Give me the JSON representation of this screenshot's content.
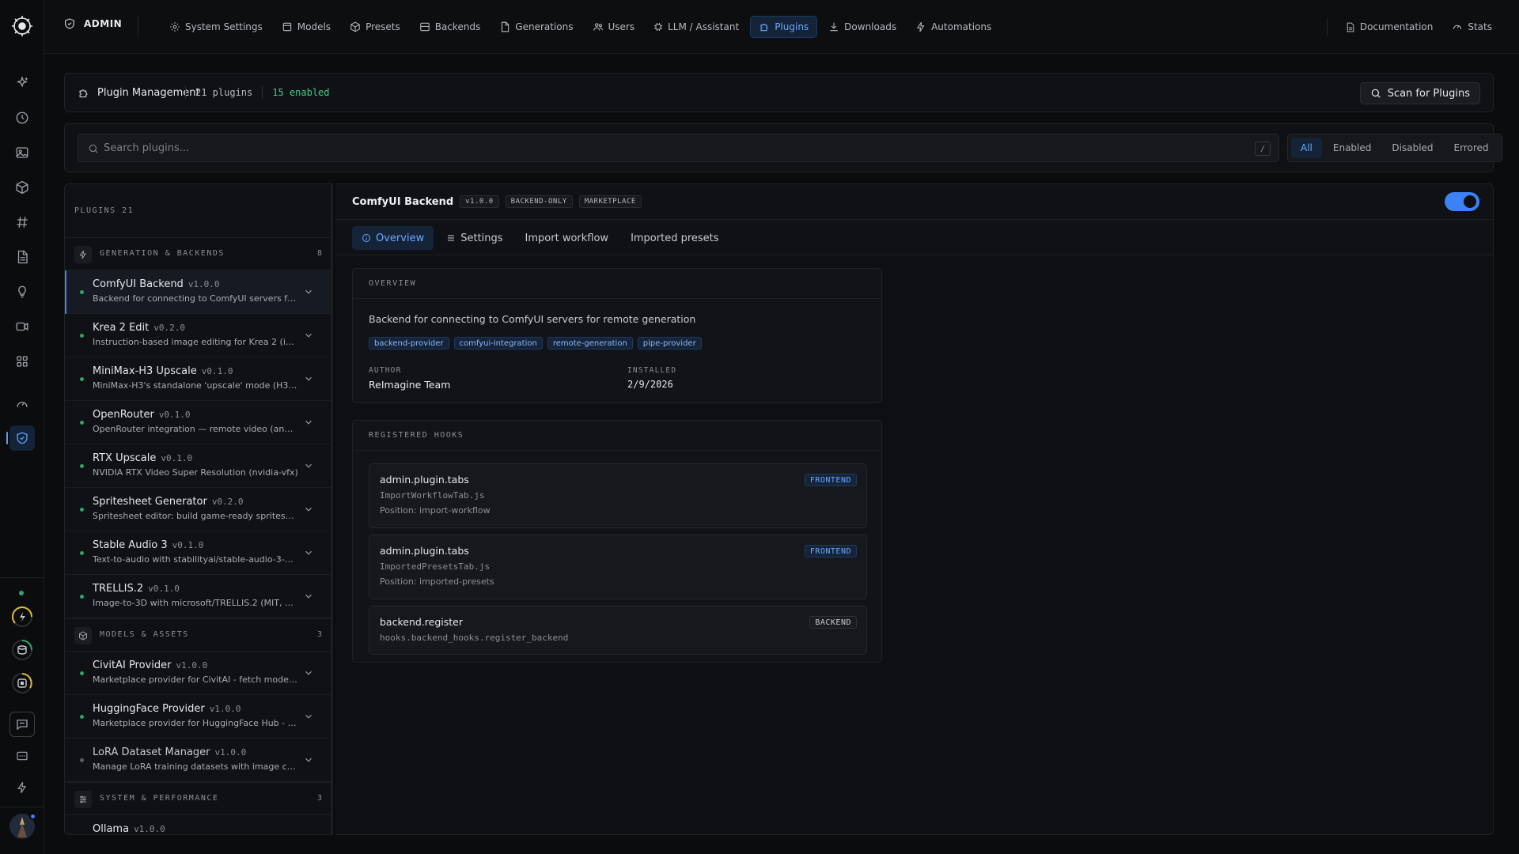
{
  "topbar": {
    "admin_label": "ADMIN",
    "nav": [
      {
        "label": "System Settings",
        "icon": "gear-icon"
      },
      {
        "label": "Models",
        "icon": "box-icon"
      },
      {
        "label": "Presets",
        "icon": "cube-icon"
      },
      {
        "label": "Backends",
        "icon": "server-icon"
      },
      {
        "label": "Generations",
        "icon": "file-icon"
      },
      {
        "label": "Users",
        "icon": "users-icon"
      },
      {
        "label": "LLM / Assistant",
        "icon": "cpu-icon"
      },
      {
        "label": "Plugins",
        "icon": "puzzle-icon",
        "active": true
      },
      {
        "label": "Downloads",
        "icon": "download-icon"
      },
      {
        "label": "Automations",
        "icon": "bolt-icon"
      }
    ],
    "right": [
      {
        "label": "Documentation",
        "icon": "doc-icon"
      },
      {
        "label": "Stats",
        "icon": "gauge-icon"
      }
    ]
  },
  "header": {
    "title": "Plugin Management",
    "plugin_count": "21 plugins",
    "enabled_count": "15 enabled",
    "scan_label": "Scan for Plugins"
  },
  "search": {
    "placeholder": "Search plugins...",
    "shortcut": "/",
    "filters": [
      "All",
      "Enabled",
      "Disabled",
      "Errored"
    ],
    "active_filter": "All"
  },
  "sidebar": {
    "heading": "PLUGINS 21",
    "groups": [
      {
        "label": "GENERATION & BACKENDS",
        "count": "8",
        "icon": "bolt-icon"
      },
      {
        "label": "MODELS & ASSETS",
        "count": "3",
        "icon": "cube-icon"
      },
      {
        "label": "SYSTEM & PERFORMANCE",
        "count": "3",
        "icon": "sliders-icon"
      }
    ],
    "items": [
      {
        "name": "ComfyUI Backend",
        "version": "v1.0.0",
        "desc": "Backend for connecting to ComfyUI servers for remote generation",
        "enabled": true,
        "selected": true
      },
      {
        "name": "Krea 2 Edit",
        "version": "v0.2.0",
        "desc": "Instruction-based image editing for Krea 2 (image-to-image)",
        "enabled": true
      },
      {
        "name": "MiniMax-H3 Upscale",
        "version": "v0.1.0",
        "desc": "MiniMax-H3's standalone 'upscale' mode (H3 upscale model)",
        "enabled": true
      },
      {
        "name": "OpenRouter",
        "version": "v0.1.0",
        "desc": "OpenRouter integration — remote video (and image) generation",
        "enabled": true
      },
      {
        "name": "RTX Upscale",
        "version": "v0.1.0",
        "desc": "NVIDIA RTX Video Super Resolution (nvidia-vfx)",
        "enabled": true
      },
      {
        "name": "Spritesheet Generator",
        "version": "v0.2.0",
        "desc": "Spritesheet editor: build game-ready spritesheets",
        "enabled": true
      },
      {
        "name": "Stable Audio 3",
        "version": "v0.1.0",
        "desc": "Text-to-audio with stabilityai/stable-audio-3-medium",
        "enabled": true
      },
      {
        "name": "TRELLIS.2",
        "version": "v0.1.0",
        "desc": "Image-to-3D with microsoft/TRELLIS.2 (MIT, 4B)",
        "enabled": true
      },
      {
        "name": "CivitAI Provider",
        "version": "v1.0.0",
        "desc": "Marketplace provider for CivitAI - fetch models and LoRAs",
        "enabled": true
      },
      {
        "name": "HuggingFace Provider",
        "version": "v1.0.0",
        "desc": "Marketplace provider for HuggingFace Hub - fetch models",
        "enabled": true
      },
      {
        "name": "LoRA Dataset Manager",
        "version": "v1.0.0",
        "desc": "Manage LoRA training datasets with image captioning",
        "enabled": false
      },
      {
        "name": "Ollama",
        "version": "v1.0.0",
        "desc": "",
        "enabled": true
      }
    ]
  },
  "detail": {
    "name": "ComfyUI Backend",
    "version": "v1.0.0",
    "tags": [
      "BACKEND-ONLY",
      "MARKETPLACE"
    ],
    "enabled": true,
    "tabs": [
      "Overview",
      "Settings",
      "Import workflow",
      "Imported presets"
    ],
    "active_tab": "Overview",
    "overview": {
      "heading": "OVERVIEW",
      "description": "Backend for connecting to ComfyUI servers for remote generation",
      "keywords": [
        "backend-provider",
        "comfyui-integration",
        "remote-generation",
        "pipe-provider"
      ],
      "author_label": "AUTHOR",
      "author": "ReImagine Team",
      "installed_label": "INSTALLED",
      "installed": "2/9/2026"
    },
    "hooks": {
      "heading": "REGISTERED HOOKS",
      "items": [
        {
          "name": "admin.plugin.tabs",
          "file": "ImportWorkflowTab.js",
          "position": "Position: import-workflow",
          "badge": "FRONTEND"
        },
        {
          "name": "admin.plugin.tabs",
          "file": "ImportedPresetsTab.js",
          "position": "Position: imported-presets",
          "badge": "FRONTEND"
        },
        {
          "name": "backend.register",
          "file": "hooks.backend_hooks.register_backend",
          "position": "",
          "badge": "BACKEND"
        }
      ]
    }
  },
  "colors": {
    "accent": "#3b82f6",
    "enabled_text": "#3ecf8e",
    "status_dot": "#2fa36b"
  }
}
